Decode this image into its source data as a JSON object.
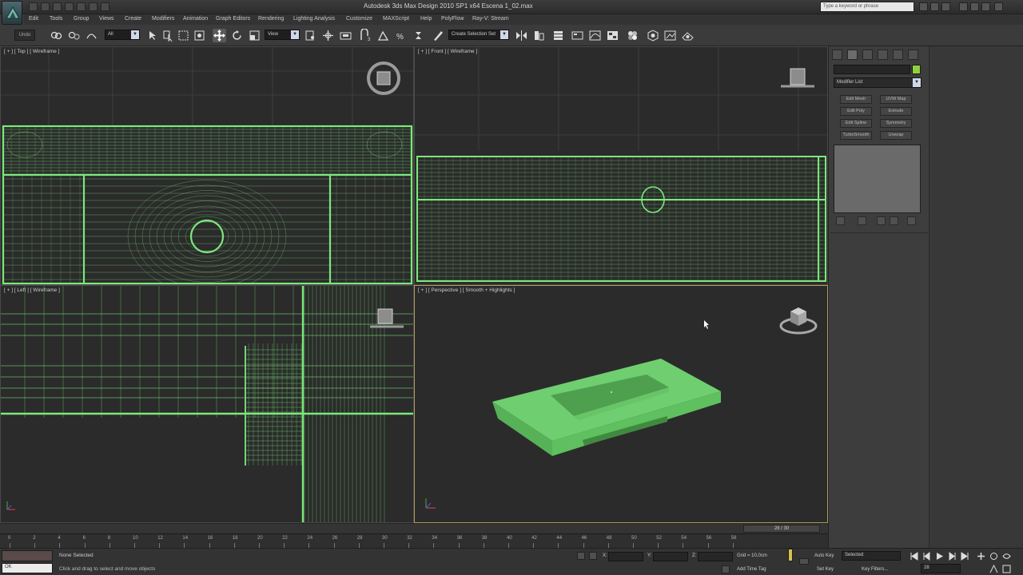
{
  "window": {
    "title": "Autodesk 3ds Max Design 2010 SP1 x64      Escena 1_02.max",
    "search_placeholder": "Type a keyword or phrase"
  },
  "menu": [
    "Edit",
    "Tools",
    "Group",
    "Views",
    "Create",
    "Modifiers",
    "Animation",
    "Graph Editors",
    "Rendering",
    "Lighting Analysis",
    "Customize",
    "MAXScript",
    "Help",
    "PolyFlow",
    "Ray-V: Stream"
  ],
  "toolbar": {
    "undo_label": "Undo",
    "selection_filter": "All",
    "reference_coord": "View",
    "named_selection": "Create Selection Set"
  },
  "viewports": {
    "top": "[ + ] [ Top ] [ Wireframe ]",
    "front": "[ + ] [ Front ] [ Wireframe ]",
    "left": "[ + ] [ Left ] [ Wireframe ]",
    "perspective": "[ + ] [ Perspective ] [ Smooth + Highlights ]"
  },
  "command_panel": {
    "modifier_list": "Modifier List",
    "buttons": [
      "Edit Mesh",
      "UVW Map",
      "Edit Poly",
      "Extrude",
      "Edit Spline",
      "Symmetry",
      "TurboSmooth",
      "Unwrap"
    ]
  },
  "timeline": {
    "frame_readout": "28 / 30",
    "ticks": [
      "0",
      "2",
      "4",
      "6",
      "8",
      "10",
      "12",
      "14",
      "16",
      "18",
      "20",
      "22",
      "24",
      "26",
      "28",
      "30",
      "32",
      "34",
      "36",
      "38",
      "40",
      "42",
      "44",
      "46",
      "48",
      "50",
      "52",
      "54",
      "56",
      "58"
    ]
  },
  "status": {
    "maxscript_value": "OK",
    "selection": "None Selected",
    "prompt": "Click and drag to select and move objects",
    "x_label": "X:",
    "y_label": "Y:",
    "z_label": "Z:",
    "grid": "Grid = 10,0cm",
    "add_time_tag": "Add Time Tag",
    "auto_key": "Auto Key",
    "set_key": "Set Key",
    "selected": "Selected",
    "key_filters": "Key Filters...",
    "frame": "28"
  },
  "colors": {
    "wire": "#7be87b",
    "model": "#6fce6f",
    "viewport_bg": "#2b2b2b"
  }
}
